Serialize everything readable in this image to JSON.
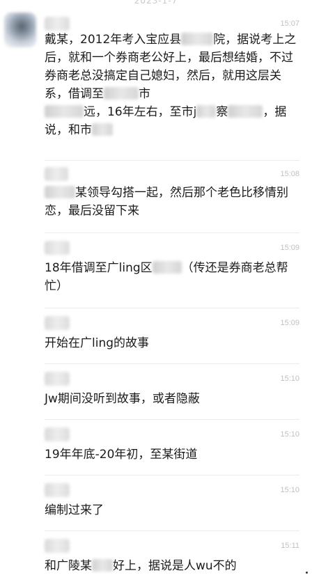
{
  "chat": {
    "date_separator": "2023-1-7",
    "messages": [
      {
        "time": "15:07",
        "segments": [
          "戴某，2012年考入宝应县",
          "院，据说考上之后，就和一个券商老公好上，最后想结婚，不过券商老总没搞定自己媳妇，然后，就用这层关系，借调至",
          "市",
          "远，16年左右，至市j",
          "察",
          "，据说，和市"
        ]
      },
      {
        "time": "15:08",
        "segments": [
          "某领导勾搭一起，然后那个老色比移情别恋，最后没留下来"
        ]
      },
      {
        "time": "15:09",
        "segments": [
          "18年借调至广ling区",
          "（传还是券商老总帮忙）"
        ]
      },
      {
        "time": "15:09",
        "segments": [
          "开始在广ling的故事"
        ]
      },
      {
        "time": "15:10",
        "segments": [
          "Jw期间没听到故事，或者隐蔽"
        ]
      },
      {
        "time": "15:10",
        "segments": [
          "19年年底-20年初，至某街道"
        ]
      },
      {
        "time": "15:10",
        "segments": [
          "编制过来了"
        ]
      },
      {
        "time": "15:11",
        "segments": [
          "和广陵某",
          "好上，据说是人wu不的"
        ]
      }
    ]
  }
}
